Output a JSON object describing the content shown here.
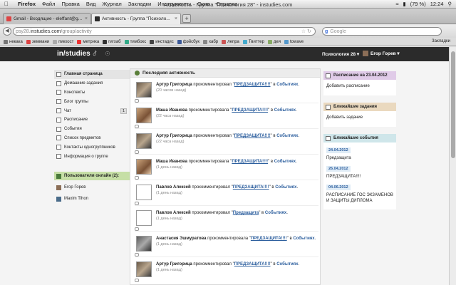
{
  "menubar": {
    "app": "Firefox",
    "items": [
      "Файл",
      "Правка",
      "Вид",
      "Журнал",
      "Закладки",
      "Инструменты",
      "Окно",
      "Справка"
    ],
    "window_title": "Активность - Группа \"Психология 28\" - instudies.com",
    "battery": "(79 %)",
    "clock": "12:24"
  },
  "tabs": [
    {
      "label": "Gmail - Входящие - eleffant@g...",
      "active": false
    },
    {
      "label": "Активность - Группа \"Психоло...",
      "active": true
    }
  ],
  "navbar": {
    "url_gray": "psy28.",
    "url_main": "instudies.com",
    "url_path": "/group/activity",
    "search_placeholder": "Google"
  },
  "bookmarks": [
    "некака",
    "земмани",
    "пикхост",
    "метрика",
    "гигхаб",
    "тимбокс",
    "инстадис",
    "фэйсбук",
    "хабр",
    "лепра",
    "Твиттер",
    "дея",
    "towave"
  ],
  "bookmarks_right": "Закладки",
  "header": {
    "logo": "in/studies",
    "group": "Психология 28",
    "user": "Егор Горев"
  },
  "leftnav": {
    "items": [
      {
        "label": "Главная страница",
        "active": true
      },
      {
        "label": "Домашние задания"
      },
      {
        "label": "Конспекты"
      },
      {
        "label": "Блог группы"
      },
      {
        "label": "Чат",
        "badge": "1"
      },
      {
        "label": "Расписание"
      },
      {
        "label": "События"
      },
      {
        "label": "Список предметов"
      },
      {
        "label": "Контакты одногруппников"
      },
      {
        "label": "Информация о группе"
      }
    ],
    "online_title": "Пользователи онлайн (2):",
    "online_users": [
      "Егор Горев",
      "Maxim Tihon"
    ]
  },
  "feed": {
    "title": "Последняя активность",
    "items": [
      {
        "author": "Артур Григорица",
        "action": " прокомментировал \"",
        "target": "ПРЕДЗАЩИТА!!!!",
        "tail": "\" в ",
        "place": "Событиях",
        "time": "(20 часов назад)"
      },
      {
        "author": "Маша Иванова",
        "action": " прокомментировала \"",
        "target": "ПРЕДЗАЩИТА!!!!",
        "tail": "\" в ",
        "place": "Событиях",
        "time": "(22 часа назад)"
      },
      {
        "author": "Артур Григорица",
        "action": " прокомментировал \"",
        "target": "ПРЕДЗАЩИТА!!!!",
        "tail": "\" в ",
        "place": "Событиях",
        "time": "(22 часа назад)"
      },
      {
        "author": "Маша Иванова",
        "action": " прокомментировала \"",
        "target": "ПРЕДЗАЩИТА!!!!",
        "tail": "\" в ",
        "place": "Событиях",
        "time": "(1 день назад)"
      },
      {
        "author": "Павлов Алексей",
        "action": " прокомментировал \"",
        "target": "ПРЕДЗАЩИТА!!!!",
        "tail": "\" в ",
        "place": "Событиях",
        "time": "(1 день назад)"
      },
      {
        "author": "Павлов Алексей",
        "action": " прокомментировал \"",
        "target": "Предзащита",
        "tail": "\" в ",
        "place": "Событиях",
        "time": "(1 день назад)"
      },
      {
        "author": "Анастасия Эшмуратова",
        "action": " прокомментировала \"",
        "target": "ПРЕДЗАЩИТА!!!!",
        "tail": "\" в ",
        "place": "Событиях",
        "time": "(1 день назад)"
      },
      {
        "author": "Артур Григорица",
        "action": " прокомментировал \"",
        "target": "ПРЕДЗАЩИТА!!!!",
        "tail": "\" в ",
        "place": "Событиях",
        "time": "(1 день назад)"
      }
    ]
  },
  "right": {
    "schedule_title": "Расписание на 23.04.2012",
    "schedule_add": "Добавить расписание",
    "tasks_title": "Ближайшие задания",
    "tasks_add": "Добавить задание",
    "events_title": "Ближайшие события",
    "events": [
      {
        "date": "24.04.2012",
        "text": "Предзащита"
      },
      {
        "date": "26.04.2012",
        "text": "ПРЕДЗАЩИТА!!!!"
      },
      {
        "date": "04.06.2012",
        "text": "РАСПИСАНИЕ ГОС ЭКЗАМЕНОВ И ЗАЩИТЫ ДИПЛОМА"
      }
    ]
  },
  "colors": {
    "header_bg": "#2b2b2b",
    "link": "#2d5f9e",
    "online_bg": "#c6dfa6",
    "schedule_bg": "#e0cbe8",
    "tasks_bg": "#ead9bf",
    "events_bg": "#cfe6ea"
  }
}
